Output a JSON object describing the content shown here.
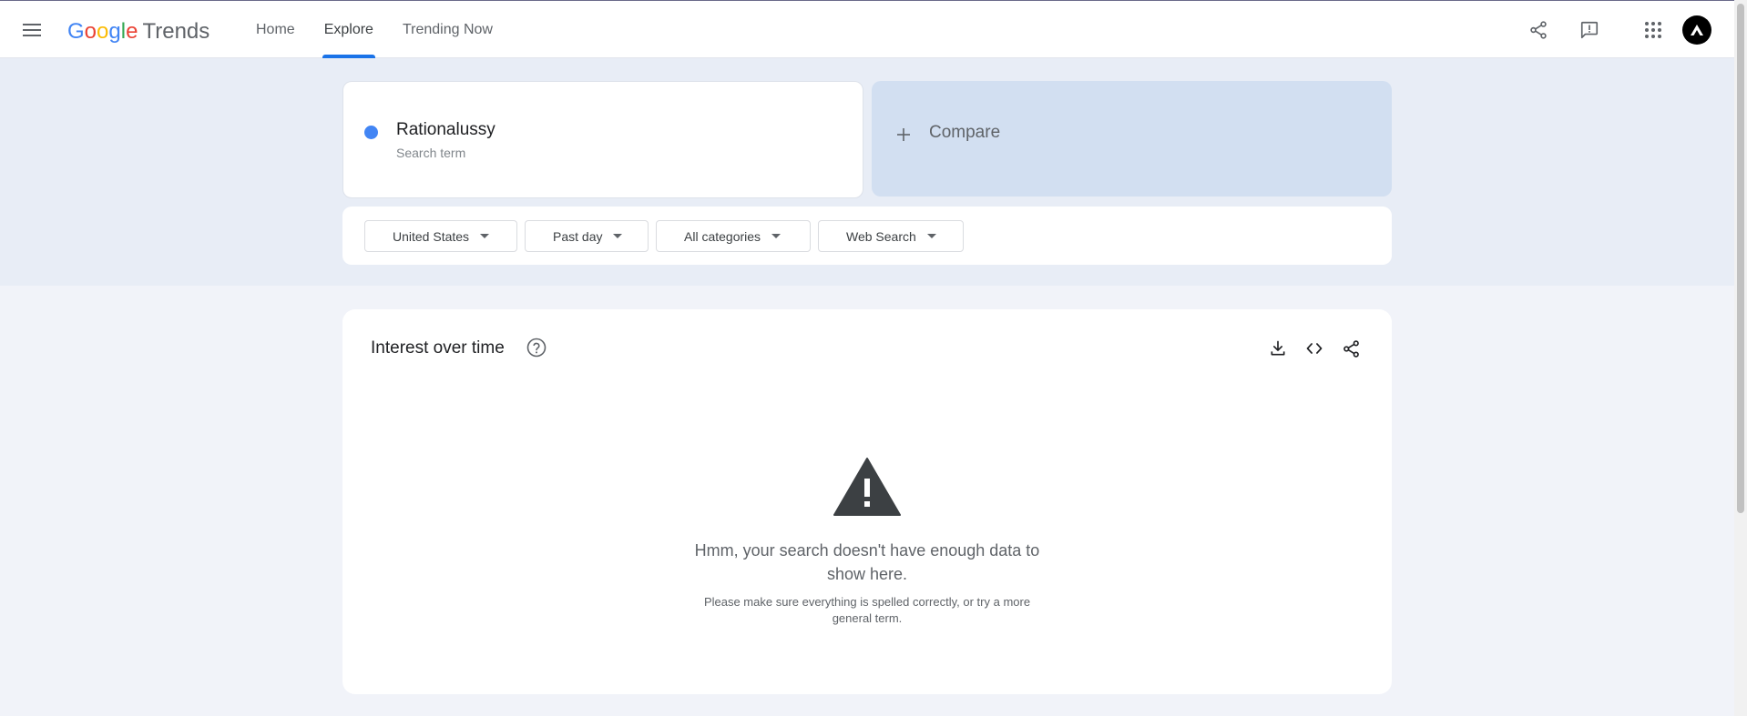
{
  "header": {
    "logo": {
      "letters": [
        {
          "ch": "G",
          "color": "#4285f4"
        },
        {
          "ch": "o",
          "color": "#ea4335"
        },
        {
          "ch": "o",
          "color": "#fbbc05"
        },
        {
          "ch": "g",
          "color": "#4285f4"
        },
        {
          "ch": "l",
          "color": "#34a853"
        },
        {
          "ch": "e",
          "color": "#ea4335"
        }
      ],
      "product": "Trends"
    },
    "nav": [
      {
        "label": "Home",
        "active": false
      },
      {
        "label": "Explore",
        "active": true
      },
      {
        "label": "Trending Now",
        "active": false
      }
    ],
    "icons": [
      "menu-icon",
      "share-icon",
      "feedback-icon",
      "apps-icon",
      "account-avatar"
    ]
  },
  "search": {
    "term": "Rationalussy",
    "term_type": "Search term",
    "term_color": "#4285f4",
    "compare_label": "Compare"
  },
  "filters": {
    "region": "United States",
    "time_range": "Past day",
    "category": "All categories",
    "property": "Web Search"
  },
  "interest_over_time": {
    "title": "Interest over time",
    "message_main": "Hmm, your search doesn't have enough data to show here.",
    "message_sub": "Please make sure everything is spelled correctly, or try a more general term.",
    "actions": [
      "download-icon",
      "embed-icon",
      "share-icon"
    ]
  },
  "colors": {
    "accent": "#1a73e8",
    "band": "#e8edf6",
    "compare_bg": "#d2dff1"
  }
}
